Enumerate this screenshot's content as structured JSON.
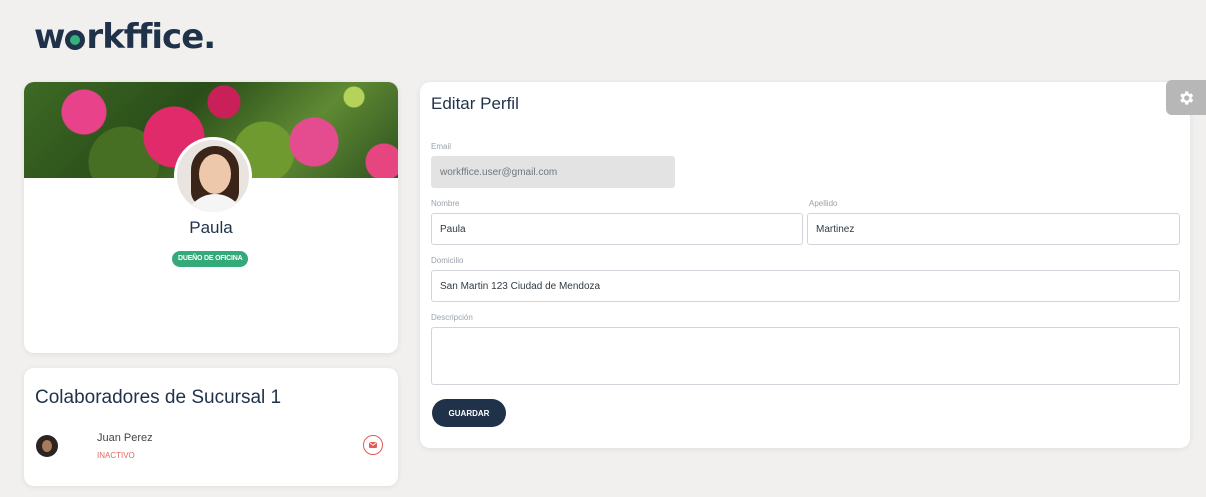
{
  "brand": {
    "logo_prefix": "w",
    "logo_suffix": "rkffice",
    "logo_dot": "."
  },
  "profile": {
    "name": "Paula",
    "role_badge": "DUEÑO DE OFICINA"
  },
  "collaborators": {
    "title": "Colaboradores de Sucursal 1",
    "items": [
      {
        "name": "Juan Perez",
        "status": "INACTIVO"
      }
    ]
  },
  "edit_profile": {
    "title": "Editar Perfil",
    "email": {
      "label": "Email",
      "value": "workffice.user@gmail.com"
    },
    "first_name": {
      "label": "Nombre",
      "value": "Paula"
    },
    "last_name": {
      "label": "Apellido",
      "value": "Martinez"
    },
    "address": {
      "label": "Domicilio",
      "value": "San Martin 123 Ciudad de Mendoza"
    },
    "description": {
      "label": "Descripción",
      "value": ""
    },
    "save_label": "GUARDAR"
  },
  "icons": {
    "settings": "gear-icon",
    "mail": "mail-icon"
  },
  "colors": {
    "brand_navy": "#1f3249",
    "brand_green": "#34a97a",
    "inactive_red": "#e0695f"
  }
}
